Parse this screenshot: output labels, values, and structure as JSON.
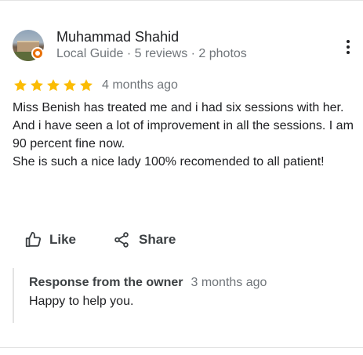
{
  "reviewer": {
    "name": "Muhammad Shahid",
    "meta": "Local Guide · 5 reviews · 2 photos",
    "avatar": "reviewer-photo",
    "badge": "local-guide-badge"
  },
  "rating": {
    "stars": 5,
    "max_stars": 5,
    "star_color": "#fbbc04",
    "date": "4 months ago"
  },
  "review": {
    "paragraphs": [
      "Miss Benish has treated me and i had six sessions with her. And i have seen a lot of improvement in all the sessions. I am 90 percent fine now.",
      "She is such a nice lady 100% recomended to all patient!"
    ]
  },
  "actions": {
    "like_label": "Like",
    "like_icon": "thumbs-up-icon",
    "share_label": "Share",
    "share_icon": "share-icon"
  },
  "owner_response": {
    "title": "Response from the owner",
    "date": "3 months ago",
    "text": "Happy to help you."
  },
  "menu": {
    "icon": "more-vert-icon"
  }
}
